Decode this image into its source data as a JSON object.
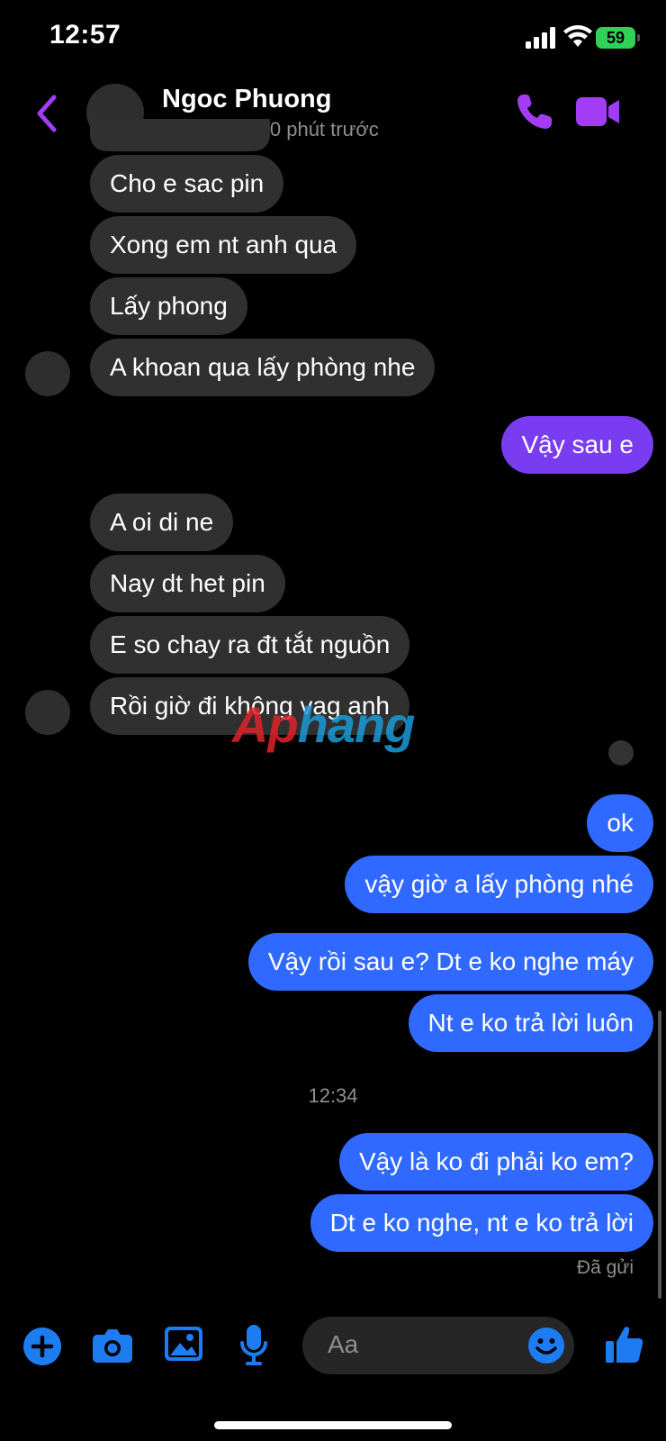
{
  "status_bar": {
    "time": "12:57",
    "battery": "59"
  },
  "header": {
    "name": "Ngoc Phuong",
    "activity": "Hoạt động 50 phút trước"
  },
  "messages": [
    {
      "side": "in",
      "text": "Cho e sac pin"
    },
    {
      "side": "in",
      "text": "Xong em nt anh qua"
    },
    {
      "side": "in",
      "text": "Lấy phong"
    },
    {
      "side": "in",
      "text": "A khoan qua lấy phòng nhe"
    },
    {
      "side": "out",
      "text": "Vậy sau e"
    },
    {
      "side": "in",
      "text": "A oi di ne"
    },
    {
      "side": "in",
      "text": "Nay dt het pin"
    },
    {
      "side": "in",
      "text": "E so chay ra đt tắt nguồn"
    },
    {
      "side": "in",
      "text": "Rồi giờ đi không vag anh"
    },
    {
      "side": "out",
      "text": "ok"
    },
    {
      "side": "out",
      "text": "vậy giờ a lấy phòng nhé"
    },
    {
      "side": "out",
      "text": "Vậy rồi sau e? Dt e ko nghe máy"
    },
    {
      "side": "out",
      "text": "Nt e ko trả lời luôn"
    },
    {
      "side": "out",
      "text": "Vậy là ko đi phải ko em?"
    },
    {
      "side": "out",
      "text": "Dt e ko nghe, nt e ko trả lời"
    }
  ],
  "timestamp": "12:34",
  "delivery_status": "Đã gửi",
  "watermark": {
    "part1": "Ap",
    "part2": "hang"
  },
  "composer": {
    "placeholder": "Aa"
  },
  "colors": {
    "accent": "#a33cf5",
    "outgoing_blue": "#3069ff",
    "outgoing_purple": "#7a3cf0",
    "incoming": "#303030"
  }
}
